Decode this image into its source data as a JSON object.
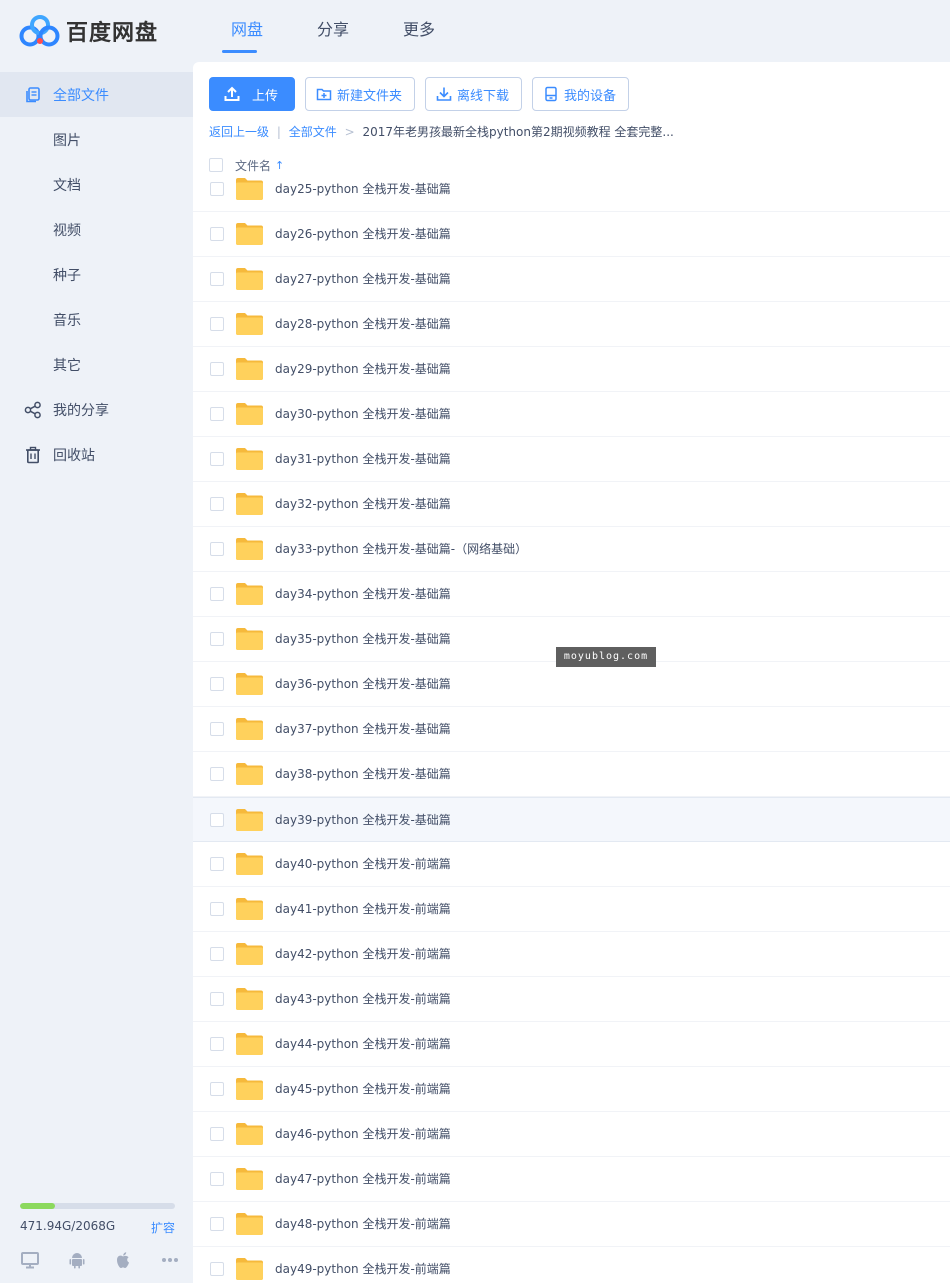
{
  "app": {
    "logo_text": "百度网盘",
    "nav": [
      {
        "label": "网盘",
        "active": true
      },
      {
        "label": "分享",
        "active": false
      },
      {
        "label": "更多",
        "active": false
      }
    ]
  },
  "sidebar": {
    "items": [
      {
        "label": "全部文件",
        "icon": "files-icon",
        "active": true
      },
      {
        "label": "图片"
      },
      {
        "label": "文档"
      },
      {
        "label": "视频"
      },
      {
        "label": "种子"
      },
      {
        "label": "音乐"
      },
      {
        "label": "其它"
      },
      {
        "label": "我的分享",
        "icon": "share-icon"
      },
      {
        "label": "回收站",
        "icon": "trash-icon"
      }
    ],
    "storage": {
      "used_text": "471.94G/2068G",
      "used_fraction": 0.228,
      "expand_label": "扩容"
    },
    "devices": [
      "desktop-icon",
      "android-icon",
      "apple-icon",
      "more-icon"
    ]
  },
  "toolbar": {
    "upload": "上传",
    "new_folder": "新建文件夹",
    "offline_download": "离线下载",
    "my_devices": "我的设备"
  },
  "breadcrumb": {
    "back": "返回上一级",
    "divider": "|",
    "root": "全部文件",
    "arrow": ">",
    "current": "2017年老男孩最新全栈python第2期视频教程 全套完整..."
  },
  "list": {
    "header": "文件名",
    "sort_indicator": "↑",
    "rows": [
      "day25-python 全栈开发-基础篇",
      "day26-python 全栈开发-基础篇",
      "day27-python 全栈开发-基础篇",
      "day28-python 全栈开发-基础篇",
      "day29-python 全栈开发-基础篇",
      "day30-python 全栈开发-基础篇",
      "day31-python 全栈开发-基础篇",
      "day32-python 全栈开发-基础篇",
      "day33-python 全栈开发-基础篇-（网络基础）",
      "day34-python 全栈开发-基础篇",
      "day35-python 全栈开发-基础篇",
      "day36-python 全栈开发-基础篇",
      "day37-python 全栈开发-基础篇",
      "day38-python 全栈开发-基础篇",
      "day39-python 全栈开发-基础篇",
      "day40-python 全栈开发-前端篇",
      "day41-python 全栈开发-前端篇",
      "day42-python 全栈开发-前端篇",
      "day43-python 全栈开发-前端篇",
      "day44-python 全栈开发-前端篇",
      "day45-python 全栈开发-前端篇",
      "day46-python 全栈开发-前端篇",
      "day47-python 全栈开发-前端篇",
      "day48-python 全栈开发-前端篇",
      "day49-python 全栈开发-前端篇"
    ],
    "hover_row": 14
  },
  "watermark": "moyublog.com",
  "colors": {
    "accent": "#3b8cff",
    "folder": "#ffd15c",
    "storage_bar": "#8bd95d"
  }
}
